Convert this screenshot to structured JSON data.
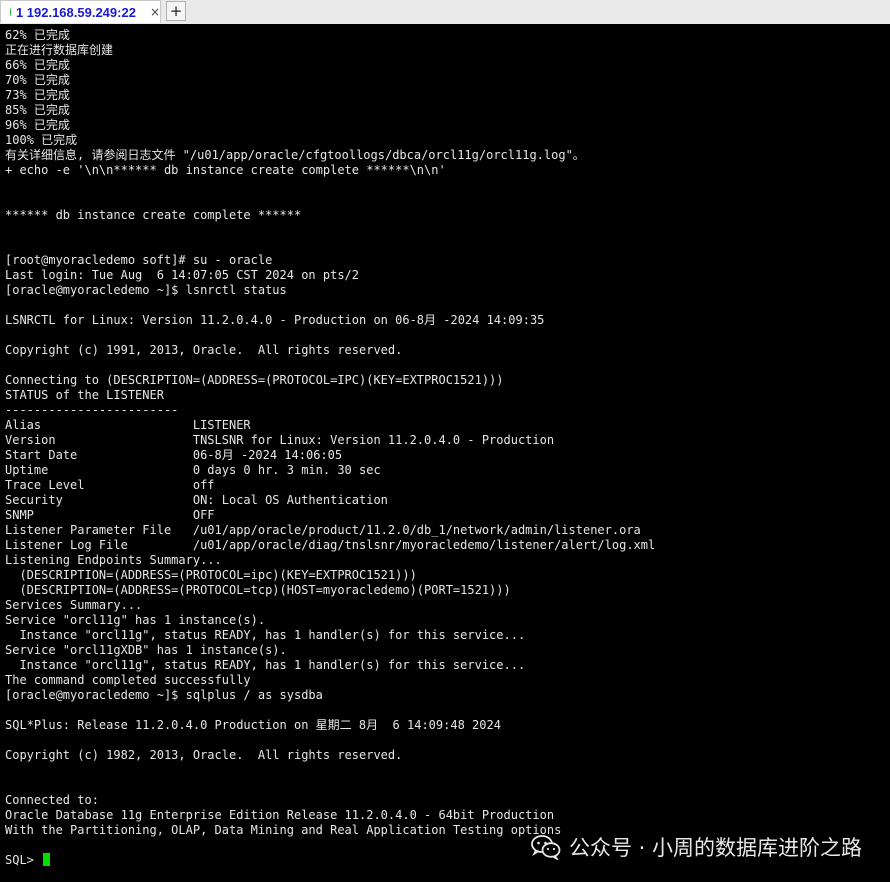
{
  "tab": {
    "title": "1 192.168.59.249:22",
    "close_glyph": "×",
    "new_tab_glyph": "+"
  },
  "terminal": {
    "lines": [
      "62% 已完成",
      "正在进行数据库创建",
      "66% 已完成",
      "70% 已完成",
      "73% 已完成",
      "85% 已完成",
      "96% 已完成",
      "100% 已完成",
      "有关详细信息, 请参阅日志文件 \"/u01/app/oracle/cfgtoollogs/dbca/orcl11g/orcl11g.log\"。",
      "+ echo -e '\\n\\n****** db instance create complete ******\\n\\n'",
      "",
      "",
      "****** db instance create complete ******",
      "",
      "",
      "[root@myoracledemo soft]# su - oracle",
      "Last login: Tue Aug  6 14:07:05 CST 2024 on pts/2",
      "[oracle@myoracledemo ~]$ lsnrctl status",
      "",
      "LSNRCTL for Linux: Version 11.2.0.4.0 - Production on 06-8月 -2024 14:09:35",
      "",
      "Copyright (c) 1991, 2013, Oracle.  All rights reserved.",
      "",
      "Connecting to (DESCRIPTION=(ADDRESS=(PROTOCOL=IPC)(KEY=EXTPROC1521)))",
      "STATUS of the LISTENER",
      "------------------------",
      "Alias                     LISTENER",
      "Version                   TNSLSNR for Linux: Version 11.2.0.4.0 - Production",
      "Start Date                06-8月 -2024 14:06:05",
      "Uptime                    0 days 0 hr. 3 min. 30 sec",
      "Trace Level               off",
      "Security                  ON: Local OS Authentication",
      "SNMP                      OFF",
      "Listener Parameter File   /u01/app/oracle/product/11.2.0/db_1/network/admin/listener.ora",
      "Listener Log File         /u01/app/oracle/diag/tnslsnr/myoracledemo/listener/alert/log.xml",
      "Listening Endpoints Summary...",
      "  (DESCRIPTION=(ADDRESS=(PROTOCOL=ipc)(KEY=EXTPROC1521)))",
      "  (DESCRIPTION=(ADDRESS=(PROTOCOL=tcp)(HOST=myoracledemo)(PORT=1521)))",
      "Services Summary...",
      "Service \"orcl11g\" has 1 instance(s).",
      "  Instance \"orcl11g\", status READY, has 1 handler(s) for this service...",
      "Service \"orcl11gXDB\" has 1 instance(s).",
      "  Instance \"orcl11g\", status READY, has 1 handler(s) for this service...",
      "The command completed successfully",
      "[oracle@myoracledemo ~]$ sqlplus / as sysdba",
      "",
      "SQL*Plus: Release 11.2.0.4.0 Production on 星期二 8月  6 14:09:48 2024",
      "",
      "Copyright (c) 1982, 2013, Oracle.  All rights reserved.",
      "",
      "",
      "Connected to:",
      "Oracle Database 11g Enterprise Edition Release 11.2.0.4.0 - 64bit Production",
      "With the Partitioning, OLAP, Data Mining and Real Application Testing options",
      "",
      "SQL> "
    ]
  },
  "watermark": {
    "text": "公众号 · 小周的数据库进阶之路",
    "icon": "wechat-icon"
  },
  "colors": {
    "background": "#000000",
    "text": "#e6e6e6",
    "cursor": "#00e000",
    "tab_title": "#1a1ad1",
    "status_dot": "#1db31d"
  }
}
